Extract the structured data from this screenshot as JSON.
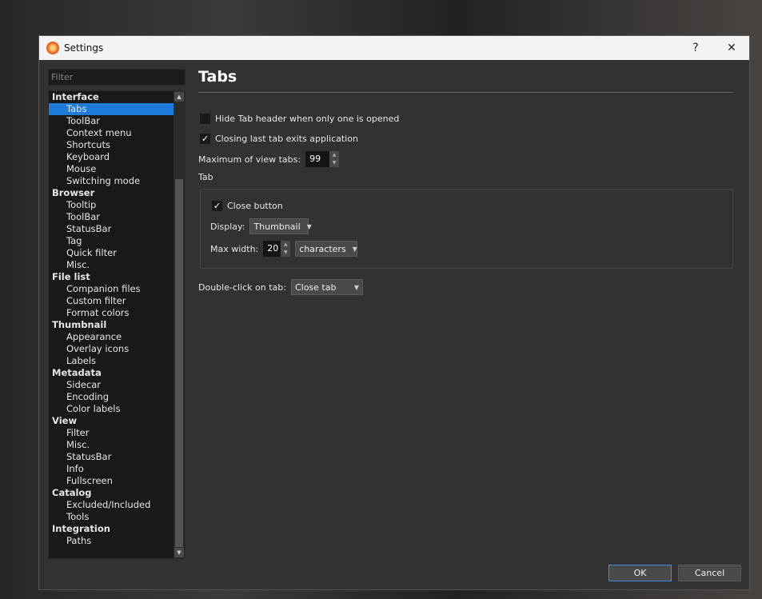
{
  "window": {
    "title": "Settings",
    "help": "?",
    "close": "✕"
  },
  "filter_placeholder": "Filter",
  "tree": [
    {
      "label": "Interface",
      "cat": true
    },
    {
      "label": "Tabs",
      "sel": true
    },
    {
      "label": "ToolBar"
    },
    {
      "label": "Context menu"
    },
    {
      "label": "Shortcuts"
    },
    {
      "label": "Keyboard"
    },
    {
      "label": "Mouse"
    },
    {
      "label": "Switching mode"
    },
    {
      "label": "Browser",
      "cat": true
    },
    {
      "label": "Tooltip"
    },
    {
      "label": "ToolBar"
    },
    {
      "label": "StatusBar"
    },
    {
      "label": "Tag"
    },
    {
      "label": "Quick filter"
    },
    {
      "label": "Misc."
    },
    {
      "label": "File list",
      "cat": true
    },
    {
      "label": "Companion files"
    },
    {
      "label": "Custom filter"
    },
    {
      "label": "Format colors"
    },
    {
      "label": "Thumbnail",
      "cat": true
    },
    {
      "label": "Appearance"
    },
    {
      "label": "Overlay icons"
    },
    {
      "label": "Labels"
    },
    {
      "label": "Metadata",
      "cat": true
    },
    {
      "label": "Sidecar"
    },
    {
      "label": "Encoding"
    },
    {
      "label": "Color labels"
    },
    {
      "label": "View",
      "cat": true
    },
    {
      "label": "Filter"
    },
    {
      "label": "Misc."
    },
    {
      "label": "StatusBar"
    },
    {
      "label": "Info"
    },
    {
      "label": "Fullscreen"
    },
    {
      "label": "Catalog",
      "cat": true
    },
    {
      "label": "Excluded/Included"
    },
    {
      "label": "Tools"
    },
    {
      "label": "Integration",
      "cat": true
    },
    {
      "label": "Paths"
    }
  ],
  "page": {
    "title": "Tabs",
    "hide_header": {
      "label": "Hide Tab header when only one is opened",
      "checked": false
    },
    "closing_last": {
      "label": "Closing last tab exits application",
      "checked": true
    },
    "max_tabs": {
      "label": "Maximum of view tabs:",
      "value": "99"
    },
    "group_title": "Tab",
    "close_button": {
      "label": "Close button",
      "checked": true
    },
    "display": {
      "label": "Display:",
      "value": "Thumbnail"
    },
    "max_width": {
      "label": "Max width:",
      "value": "20",
      "unit": "characters"
    },
    "double_click": {
      "label": "Double-click on tab:",
      "value": "Close tab"
    }
  },
  "buttons": {
    "ok": "OK",
    "cancel": "Cancel"
  }
}
